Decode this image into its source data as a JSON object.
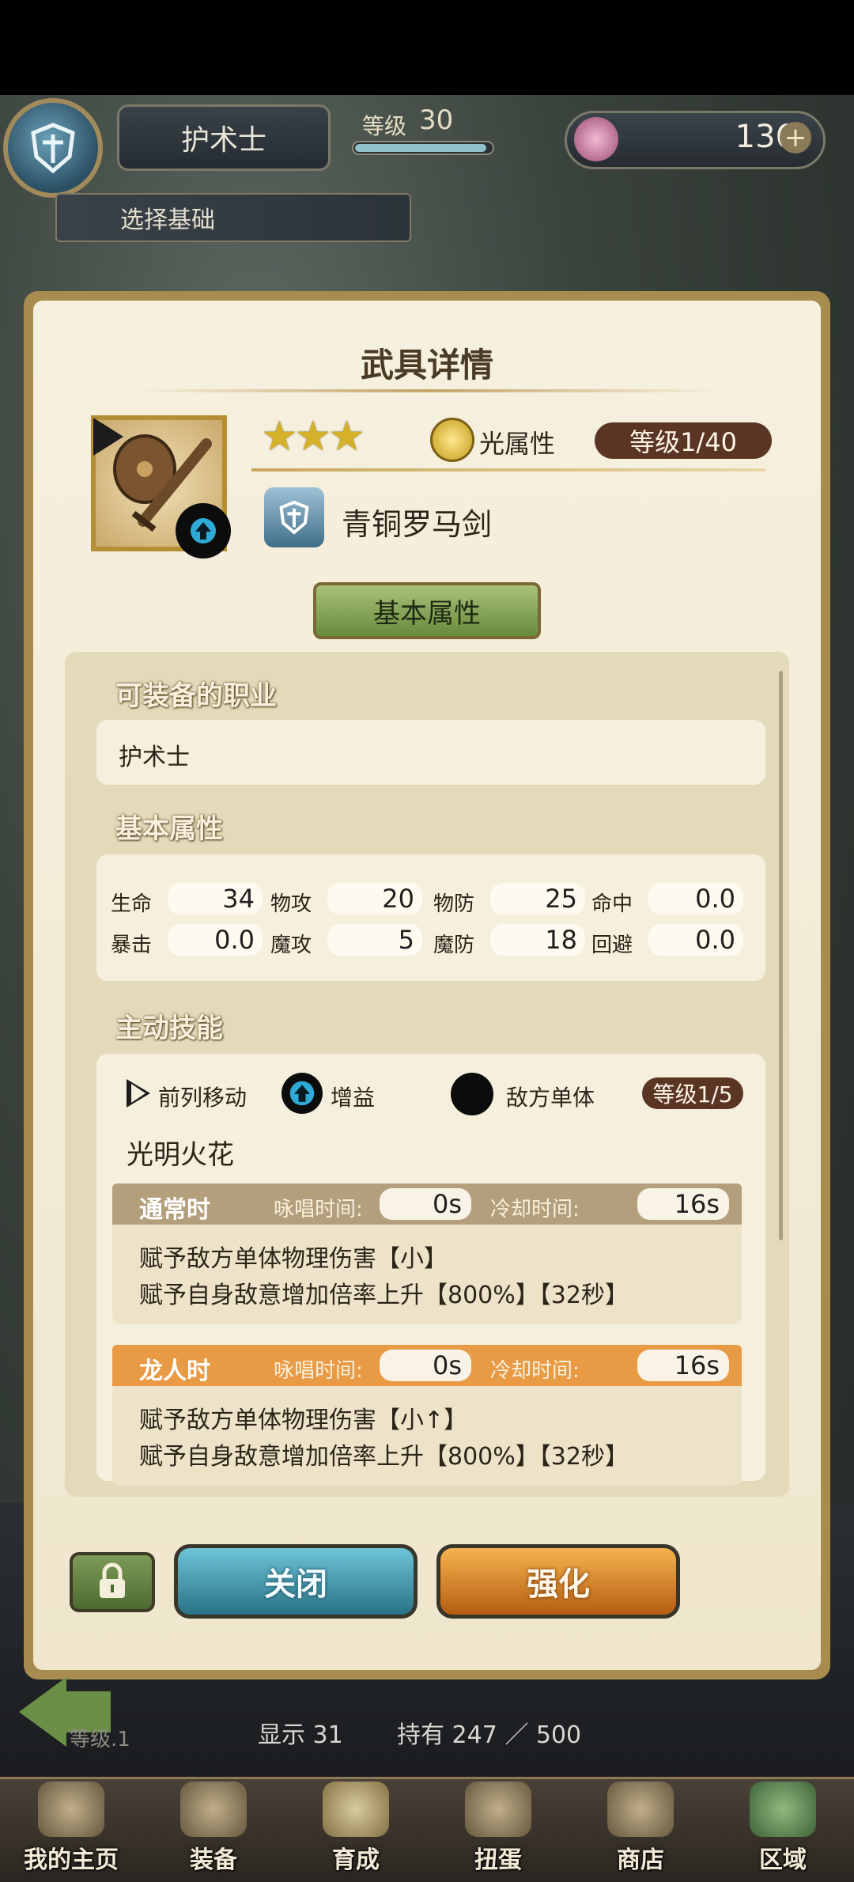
{
  "header": {
    "class_name": "护术士",
    "level_label": "等级",
    "level_value": "30",
    "gem_count": "136",
    "select_base": "选择基础"
  },
  "panel": {
    "title": "武具详情",
    "stars": "★★★",
    "attribute": "光属性",
    "level": "等级1/40",
    "weapon_name": "青铜罗马剑",
    "tab_label": "基本属性"
  },
  "jobs": {
    "heading": "可装备的职业",
    "value": "护术士"
  },
  "stats": {
    "heading": "基本属性",
    "rows": [
      [
        {
          "label": "生命",
          "value": "34"
        },
        {
          "label": "物攻",
          "value": "20"
        },
        {
          "label": "物防",
          "value": "25"
        },
        {
          "label": "命中",
          "value": "0.0"
        }
      ],
      [
        {
          "label": "暴击",
          "value": "0.0"
        },
        {
          "label": "魔攻",
          "value": "5"
        },
        {
          "label": "魔防",
          "value": "18"
        },
        {
          "label": "回避",
          "value": "0.0"
        }
      ]
    ]
  },
  "skill": {
    "heading": "主动技能",
    "tags": [
      "前列移动",
      "增益",
      "敌方单体"
    ],
    "level": "等级1/5",
    "name": "光明火花",
    "modes": [
      {
        "title": "通常时",
        "cast_label": "咏唱时间:",
        "cast": "0s",
        "cd_label": "冷却时间:",
        "cd": "16s",
        "lines": [
          "赋予敌方单体物理伤害【小】",
          "赋予自身敌意增加倍率上升【800%】【32秒】"
        ],
        "color": "#b49f7d"
      },
      {
        "title": "龙人时",
        "cast_label": "咏唱时间:",
        "cast": "0s",
        "cd_label": "冷却时间:",
        "cd": "16s",
        "lines": [
          "赋予敌方单体物理伤害【小↑】",
          "赋予自身敌意增加倍率上升【800%】【32秒】"
        ],
        "color": "#e89a45"
      }
    ]
  },
  "buttons": {
    "close": "关闭",
    "enhance": "强化"
  },
  "list_footer": {
    "level_text": "等级.1",
    "shown": "显示 31",
    "owned": "持有 247 ／ 500"
  },
  "nav": [
    {
      "label": "我的主页",
      "icon": "scroll-icon"
    },
    {
      "label": "装备",
      "icon": "helmet-icon"
    },
    {
      "label": "育成",
      "icon": "crossed-swords-icon"
    },
    {
      "label": "扭蛋",
      "icon": "gacha-icon"
    },
    {
      "label": "商店",
      "icon": "bag-icon"
    },
    {
      "label": "区域",
      "icon": "globe-icon"
    }
  ]
}
